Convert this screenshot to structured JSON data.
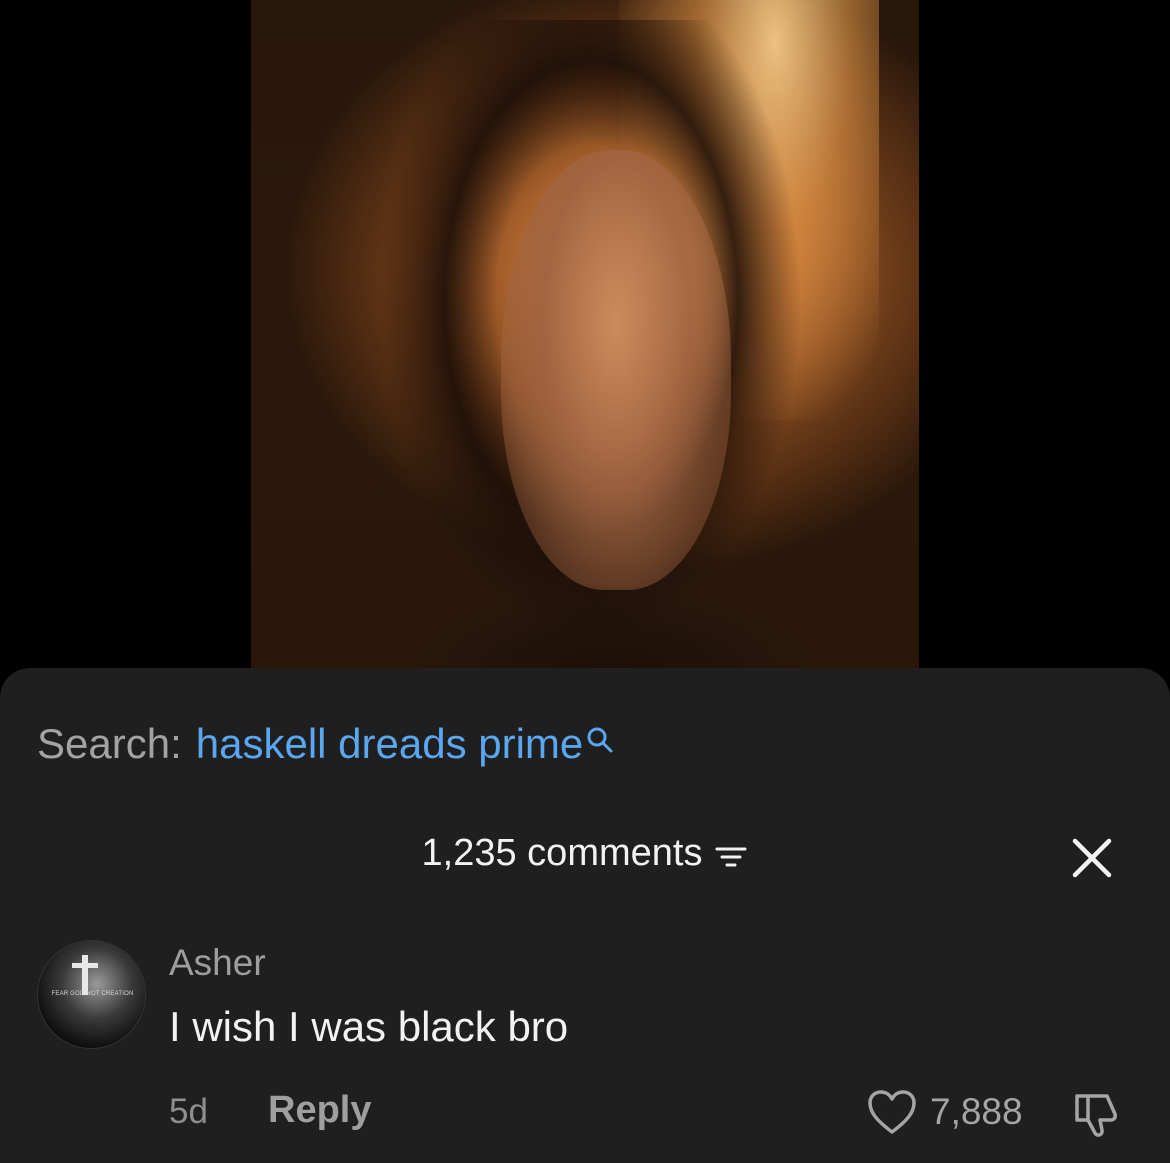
{
  "search": {
    "prefix": "Search:",
    "query": "haskell dreads prime"
  },
  "comments": {
    "count_label": "1,235 comments",
    "items": [
      {
        "username": "Asher",
        "text": "I wish I was black bro",
        "age": "5d",
        "reply_label": "Reply",
        "like_count": "7,888",
        "avatar_caption": "FEAR GOD NOT CREATION"
      }
    ]
  },
  "colors": {
    "sheet_background": "#1f1f1f",
    "search_link": "#5aa6f0",
    "primary_text": "#f2f2f2",
    "secondary_text": "#9d9d9d"
  },
  "icons": {
    "search": "search-icon",
    "filter": "filter-icon",
    "close": "close-icon",
    "like": "heart-icon",
    "dislike": "thumbs-down-icon"
  }
}
